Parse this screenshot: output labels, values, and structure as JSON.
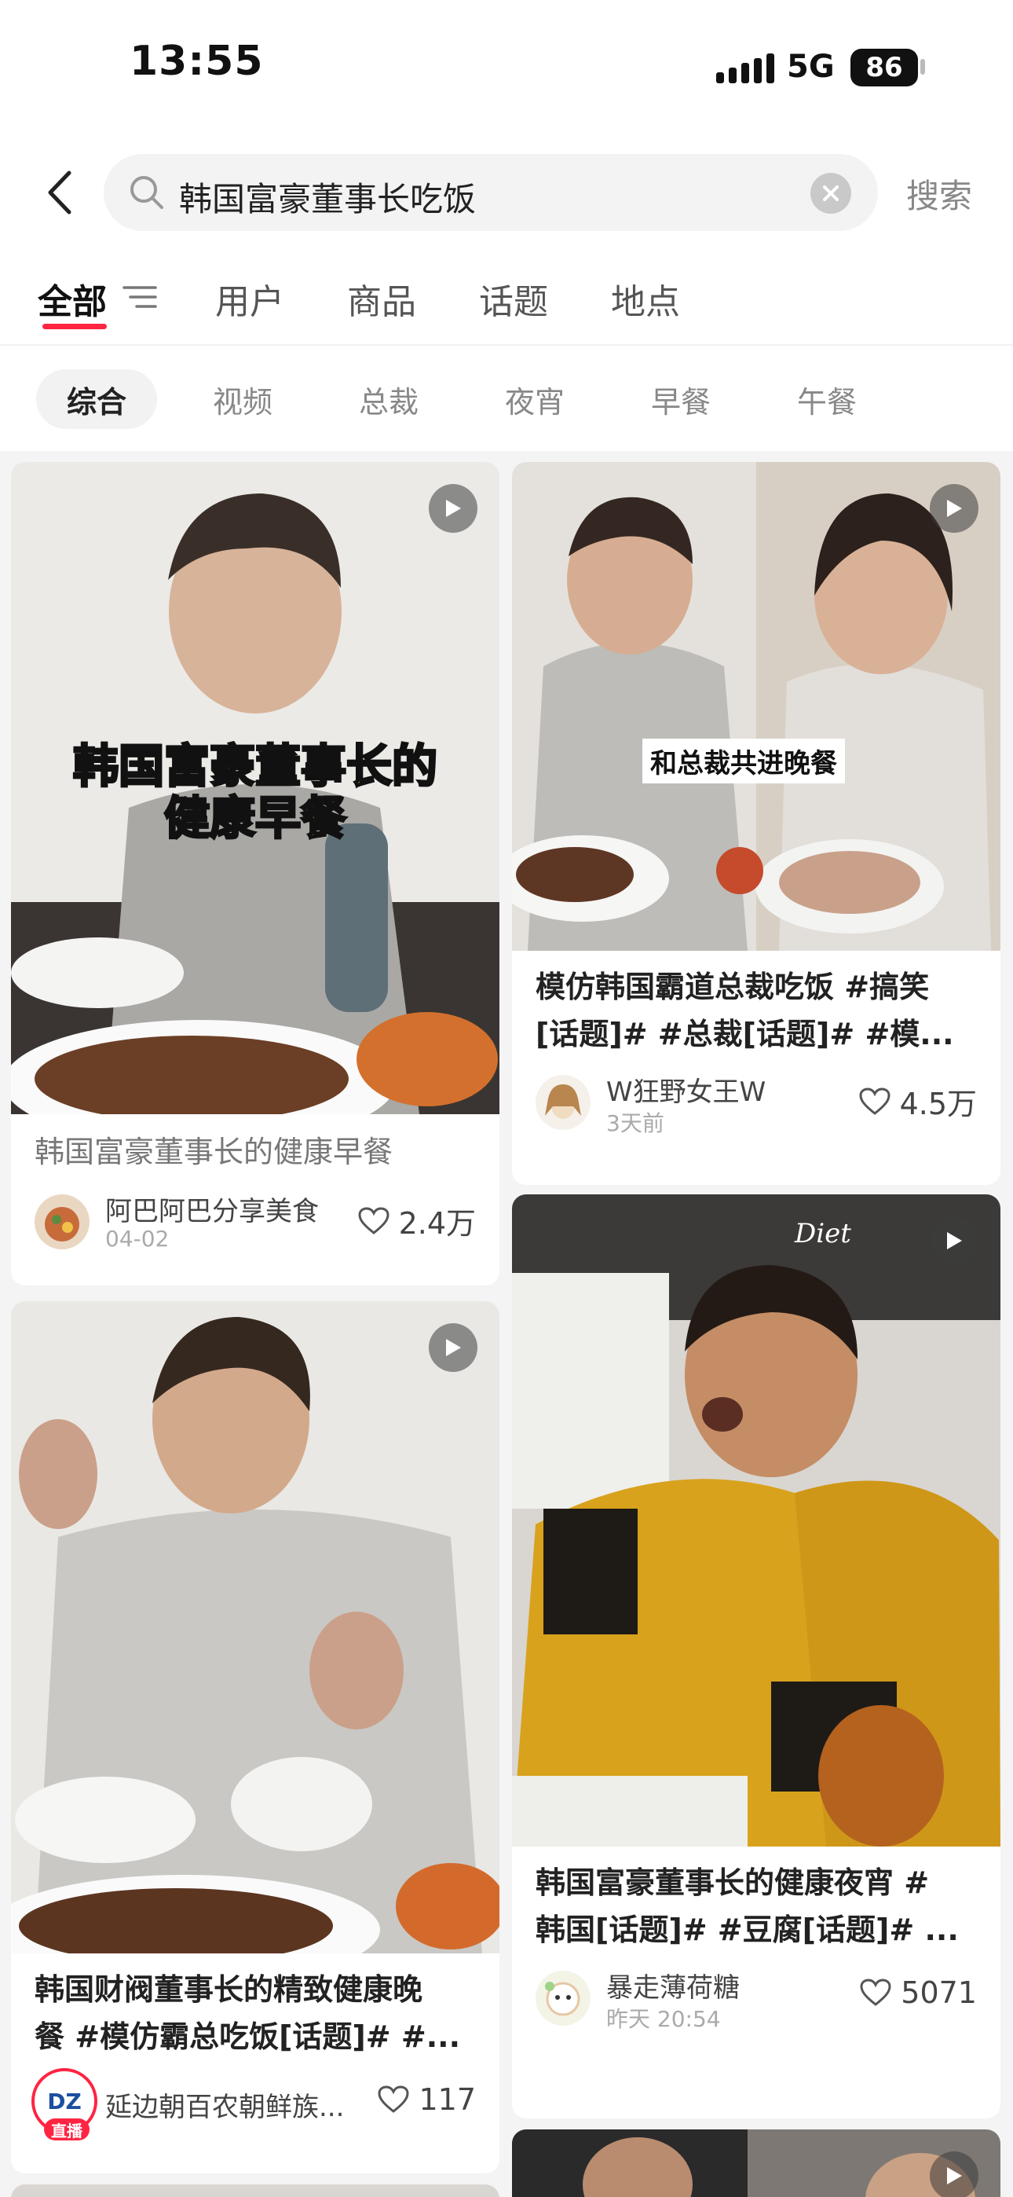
{
  "status_bar": {
    "time": "13:55",
    "network": "5G",
    "battery": "86"
  },
  "search": {
    "query": "韩国富豪董事长吃饭",
    "button_label": "搜索"
  },
  "category_tabs": [
    {
      "label": "全部",
      "active": true
    },
    {
      "label": "用户",
      "active": false
    },
    {
      "label": "商品",
      "active": false
    },
    {
      "label": "话题",
      "active": false
    },
    {
      "label": "地点",
      "active": false
    }
  ],
  "sub_tabs": [
    {
      "label": "综合",
      "active": true
    },
    {
      "label": "视频",
      "active": false
    },
    {
      "label": "总裁",
      "active": false
    },
    {
      "label": "夜宵",
      "active": false
    },
    {
      "label": "早餐",
      "active": false
    },
    {
      "label": "午餐",
      "active": false
    }
  ],
  "posts": [
    {
      "overlay_text_line1": "韩国富豪董事长的",
      "overlay_text_line2": "健康早餐",
      "title": "韩国富豪董事长的健康早餐",
      "author": "阿巴阿巴分享美食",
      "date": "04-02",
      "likes": "2.4万"
    },
    {
      "overlay_text": "和总裁共进晚餐",
      "title_line1": "模仿韩国霸道总裁吃饭 #搞笑",
      "title_line2": "[话题]# #总裁[话题]# #模...",
      "author": "W狂野女王W",
      "date": "3天前",
      "likes": "4.5万"
    },
    {
      "cover_text": "Diet",
      "title_line1": "韩国富豪董事长的健康夜宵 #",
      "title_line2": "韩国[话题]# #豆腐[话题]# ...",
      "author": "暴走薄荷糖",
      "date": "昨天 20:54",
      "likes": "5071"
    },
    {
      "title_line1": "韩国财阀董事长的精致健康晚",
      "title_line2": "餐 #模仿霸总吃饭[话题]# #...",
      "author": "延边朝百农朝鲜族...",
      "avatar_logo": "DZ",
      "live_label": "直播",
      "likes": "117"
    }
  ]
}
